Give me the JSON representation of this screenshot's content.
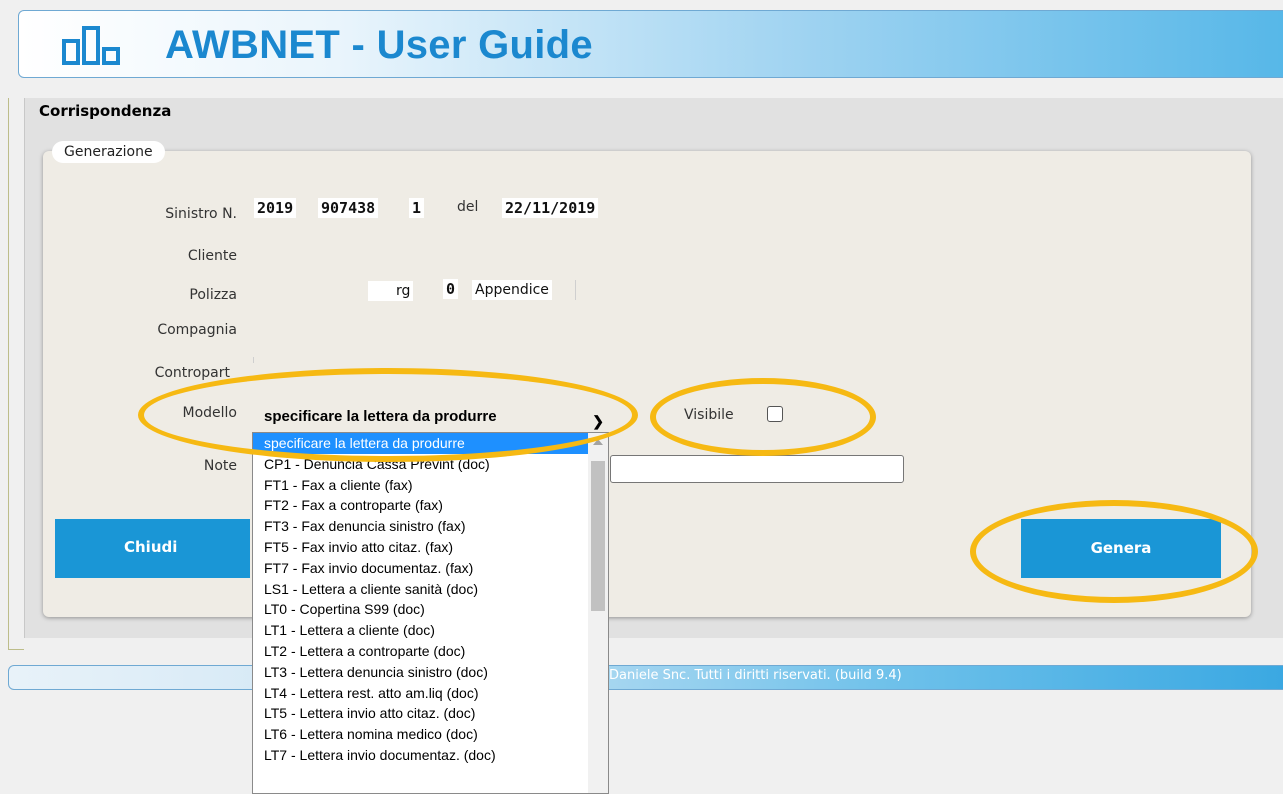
{
  "header": {
    "title": "AWBNET - User Guide",
    "logo_icon": "bar-chart-icon"
  },
  "section": {
    "title": "Corrispondenza",
    "legend": "Generazione"
  },
  "form": {
    "sinistro_label": "Sinistro N.",
    "sinistro_year": "2019",
    "sinistro_number": "907438",
    "sinistro_suffix": "1",
    "del_label": "del",
    "sinistro_date": "22/11/2019",
    "cliente_label": "Cliente",
    "polizza_label": "Polizza",
    "rg_label": "rg",
    "rg_value": "0",
    "appendice_label": "Appendice",
    "compagnia_label": "Compagnia",
    "contropart_label": "Contropart",
    "modello_label": "Modello",
    "modello_selected": "specificare la lettera da produrre",
    "visibile_label": "Visibile",
    "visibile_checked": false,
    "note_label": "Note",
    "note_value": ""
  },
  "buttons": {
    "close_label": "Chiudi",
    "generate_label": "Genera"
  },
  "dropdown": {
    "options": [
      "specificare la lettera da produrre",
      "CP1 - Denuncia Cassa Prevint (doc)",
      "FT1 - Fax a cliente (fax)",
      "FT2 - Fax a controparte (fax)",
      "FT3 - Fax denuncia sinistro (fax)",
      "FT5 - Fax invio atto citaz. (fax)",
      "FT7 - Fax invio documentaz. (fax)",
      "LS1 - Lettera a cliente sanità (doc)",
      "LT0 - Copertina S99 (doc)",
      "LT1 - Lettera a cliente (doc)",
      "LT2 - Lettera a controparte (doc)",
      "LT3 - Lettera denuncia sinistro (doc)",
      "LT4 - Lettera rest. atto am.liq (doc)",
      "LT5 - Lettera invio atto citaz. (doc)",
      "LT6 - Lettera nomina medico (doc)",
      "LT7 - Lettera invio documentaz. (doc)"
    ]
  },
  "footer": {
    "text": "Daniele Snc. Tutti i diritti riservati. (build 9.4)"
  },
  "colors": {
    "accent": "#1a96d6",
    "highlight": "#f6b913",
    "title": "#1b88cf"
  }
}
